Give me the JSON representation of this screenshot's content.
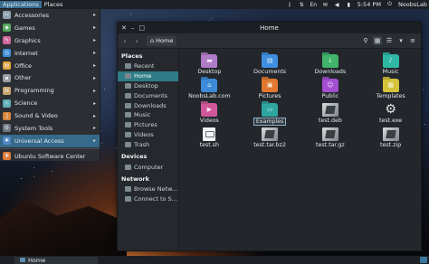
{
  "top_panel": {
    "menus": [
      "Applications",
      "Places"
    ],
    "time": "5:54 PM",
    "user": "NoobsLab",
    "indicator_icons": [
      "bluetooth-icon",
      "network-icon",
      "keyboard-layout-icon",
      "mail-icon",
      "volume-icon",
      "battery-icon",
      "power-icon"
    ],
    "keyboard_label": "En"
  },
  "apps_menu": {
    "items": [
      {
        "label": "Accessories",
        "icon": "accessories-icon",
        "color": "#8fa3b0",
        "arrow": true
      },
      {
        "label": "Games",
        "icon": "games-icon",
        "color": "#58a85c",
        "arrow": true
      },
      {
        "label": "Graphics",
        "icon": "graphics-icon",
        "color": "#d0689c",
        "arrow": true
      },
      {
        "label": "Internet",
        "icon": "internet-icon",
        "color": "#3d8fd6",
        "arrow": true
      },
      {
        "label": "Office",
        "icon": "office-icon",
        "color": "#e3a43a",
        "arrow": true
      },
      {
        "label": "Other",
        "icon": "other-icon",
        "color": "#9a9ea3",
        "arrow": true
      },
      {
        "label": "Programming",
        "icon": "programming-icon",
        "color": "#c9a36b",
        "arrow": true
      },
      {
        "label": "Science",
        "icon": "science-icon",
        "color": "#5fb0b7",
        "arrow": true
      },
      {
        "label": "Sound & Video",
        "icon": "sound-video-icon",
        "color": "#d9863b",
        "arrow": true
      },
      {
        "label": "System Tools",
        "icon": "system-tools-icon",
        "color": "#6f7a85",
        "arrow": true
      },
      {
        "label": "Universal Access",
        "icon": "universal-access-icon",
        "color": "#4f86c6",
        "arrow": true,
        "selected": true
      },
      {
        "label": "Ubuntu Software Center",
        "icon": "software-center-icon",
        "color": "#e07b39",
        "arrow": false
      }
    ]
  },
  "file_manager": {
    "title": "Home",
    "breadcrumb": "Home",
    "sidebar": {
      "sections": [
        {
          "heading": "Places",
          "items": [
            "Recent",
            "Home",
            "Desktop",
            "Documents",
            "Downloads",
            "Music",
            "Pictures",
            "Videos",
            "Trash"
          ],
          "selected": "Home"
        },
        {
          "heading": "Devices",
          "items": [
            "Computer"
          ]
        },
        {
          "heading": "Network",
          "items": [
            "Browse Netw...",
            "Connect to S..."
          ]
        }
      ]
    },
    "files": [
      {
        "name": "Desktop",
        "kind": "folder",
        "color": "#b07bc7",
        "glyph": "▬"
      },
      {
        "name": "Documents",
        "kind": "folder",
        "color": "#3e8fe0",
        "glyph": "▤"
      },
      {
        "name": "Downloads",
        "kind": "folder",
        "color": "#3fb46a",
        "glyph": "↓"
      },
      {
        "name": "Music",
        "kind": "folder",
        "color": "#2fb7a5",
        "glyph": "♪"
      },
      {
        "name": "NoobsLab.com",
        "kind": "folder",
        "color": "#3c8ad8",
        "glyph": "⌂"
      },
      {
        "name": "Pictures",
        "kind": "folder",
        "color": "#e0782f",
        "glyph": "▣"
      },
      {
        "name": "Public",
        "kind": "folder",
        "color": "#a44fd0",
        "glyph": "☺"
      },
      {
        "name": "Templates",
        "kind": "folder",
        "color": "#d4c23a",
        "glyph": "▦"
      },
      {
        "name": "Videos",
        "kind": "folder",
        "color": "#d0579a",
        "glyph": "▶"
      },
      {
        "name": "Examples",
        "kind": "folder",
        "color": "#2ea5a0",
        "glyph": "▭",
        "selected": true
      },
      {
        "name": "test.deb",
        "kind": "package"
      },
      {
        "name": "test.exe",
        "kind": "exe"
      },
      {
        "name": "test.sh",
        "kind": "script"
      },
      {
        "name": "test.tar.bz2",
        "kind": "package"
      },
      {
        "name": "test.tar.gz",
        "kind": "package"
      },
      {
        "name": "test.zip",
        "kind": "package"
      }
    ]
  },
  "taskbar": {
    "task_label": "Home"
  }
}
